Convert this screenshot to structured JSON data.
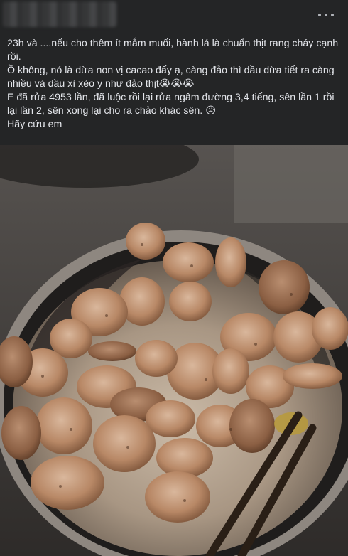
{
  "post": {
    "lines": [
      "23h và ....nếu cho thêm ít mắm muối, hành lá là chuẩn thịt rang cháy cạnh rồi.",
      "Ồ không, nó là dừa non vị cacao đấy ạ, càng đảo thì dầu dừa tiết ra càng nhiều và dầu xì xèo y như đảo thịt😭😭😭",
      "E đã rửa 4953 lần, đã luộc rồi lại rửa ngâm đường 3,4 tiếng, sên lần 1 rồi lại lần 2, sên xong lại cho ra chảo khác sên. 😥",
      "Hãy cứu em"
    ]
  },
  "icons": {
    "more": "more-horizontal-icon"
  },
  "colors": {
    "background": "#242526",
    "text": "#e4e6eb",
    "muted": "#b0b3b8"
  }
}
